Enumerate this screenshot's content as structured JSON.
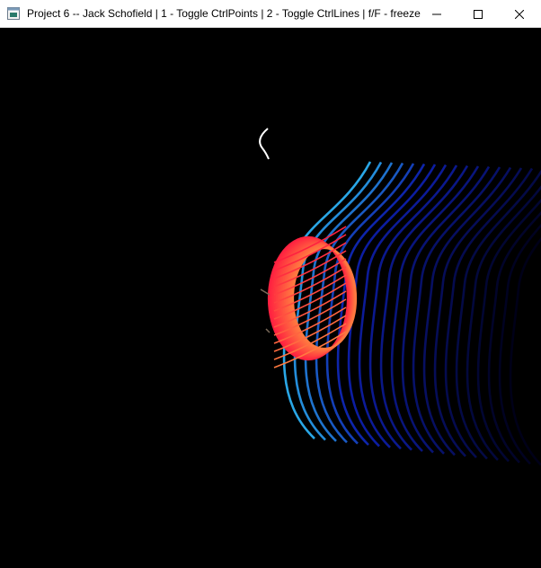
{
  "window": {
    "title": "Project 6 -- Jack Schofield | 1 - Toggle CtrlPoints | 2 - Toggle CtrlLines | f/F - freeze"
  },
  "controls": {
    "icons": [
      "app-window-icon",
      "minimize-icon",
      "maximize-icon",
      "close-icon"
    ]
  },
  "scene": {
    "background": "#000000",
    "colors": {
      "surface_near": "#2aa7e6",
      "surface_mid": "#0d1ea8",
      "surface_far": "#000018",
      "cylinder_top": "#ff2040",
      "cylinder_bottom": "#ff7a40",
      "curve": "#ffffff"
    }
  }
}
